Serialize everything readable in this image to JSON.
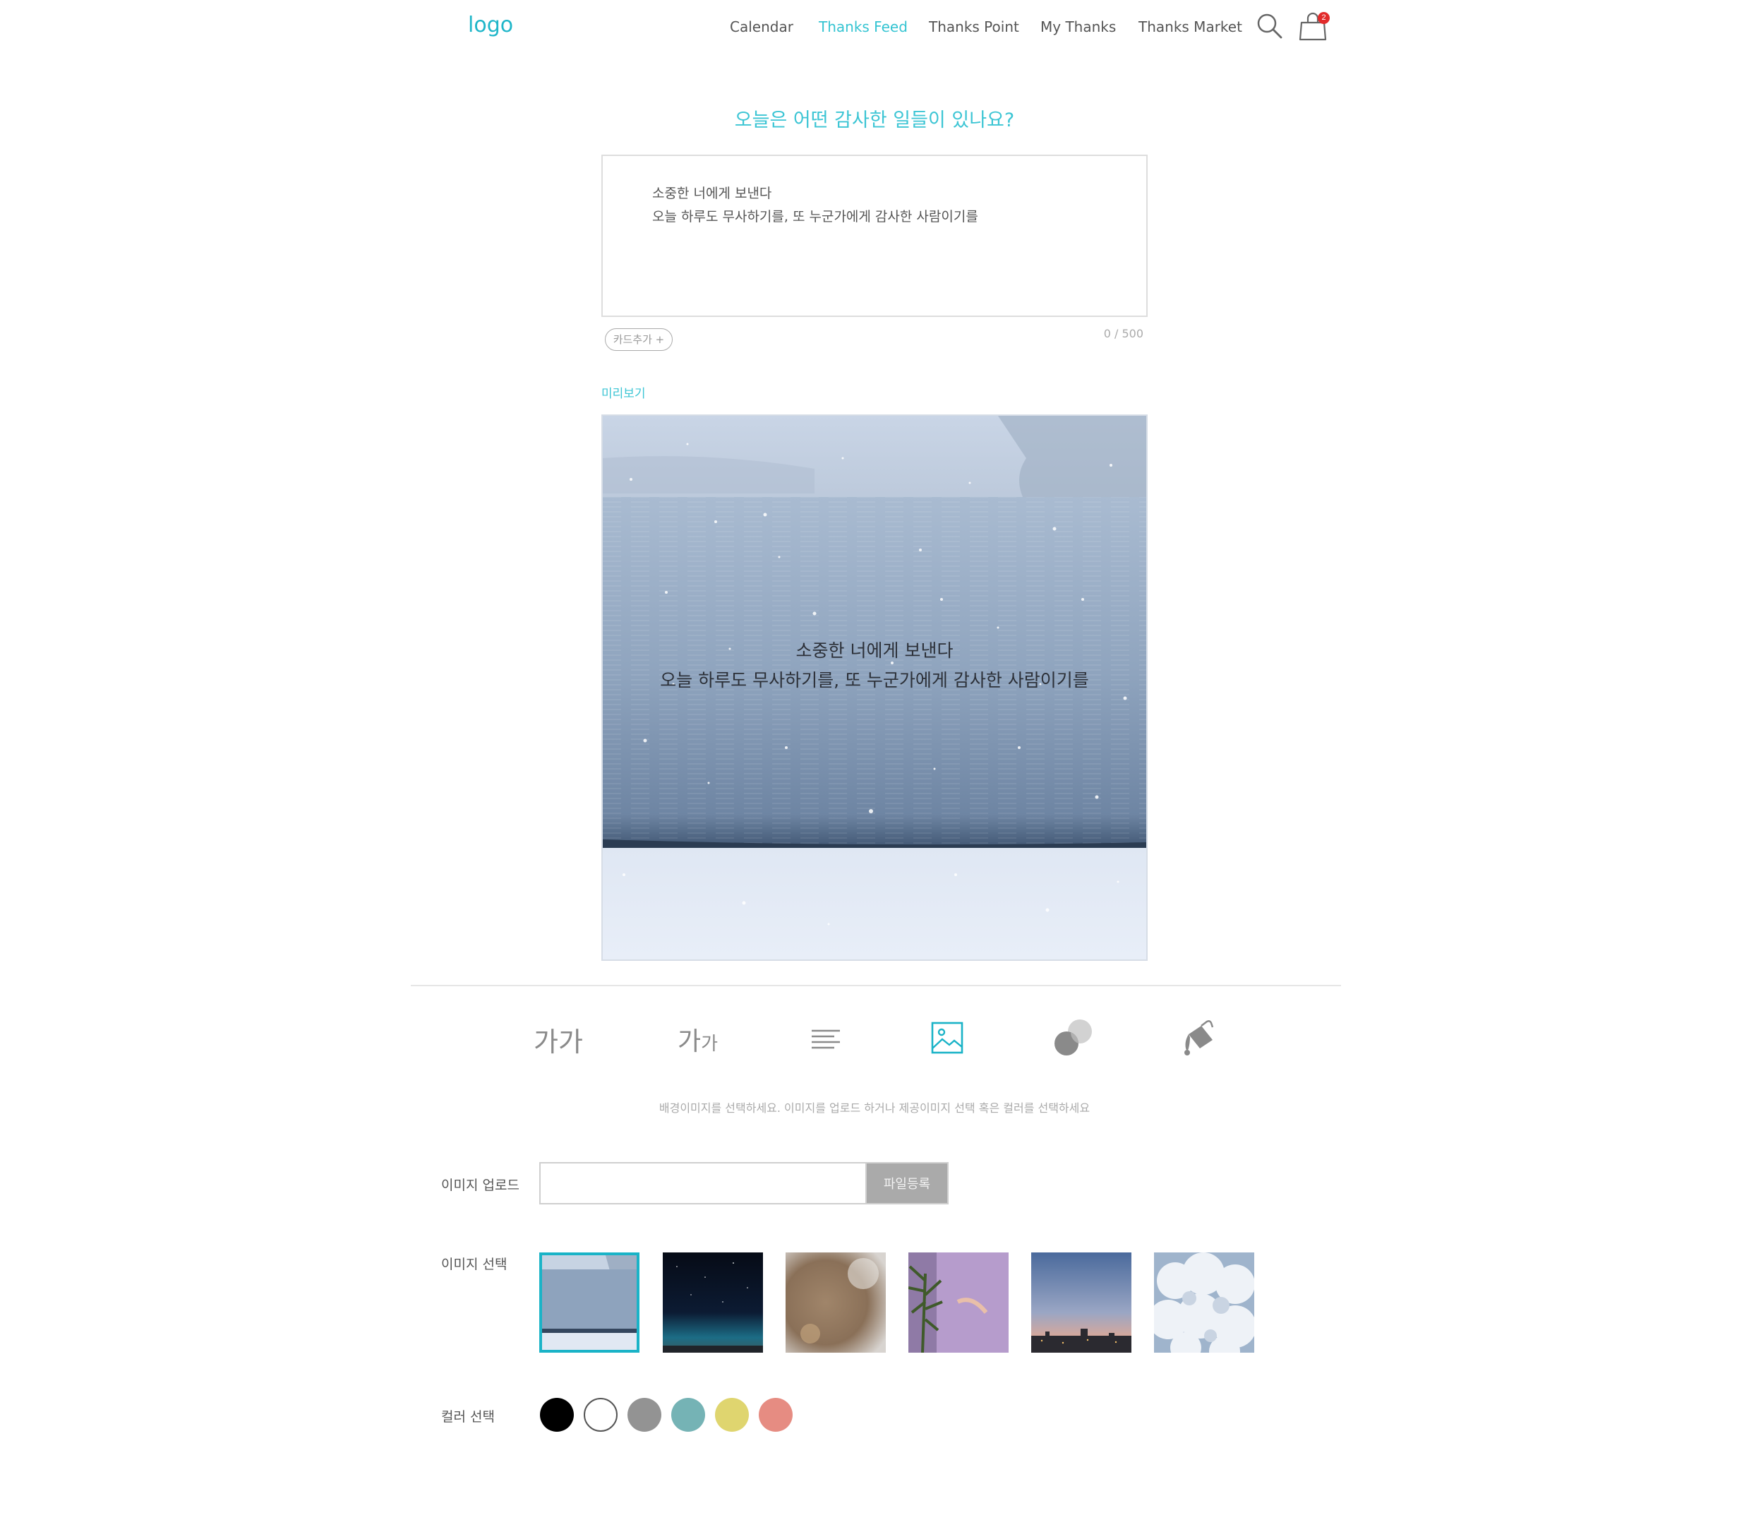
{
  "header": {
    "logo": "logo",
    "nav": [
      {
        "label": "Calendar",
        "active": false
      },
      {
        "label": "Thanks Feed",
        "active": true
      },
      {
        "label": "Thanks Point",
        "active": false
      },
      {
        "label": "My Thanks",
        "active": false
      },
      {
        "label": "Thanks Market",
        "active": false
      }
    ],
    "search_icon": "search-icon",
    "cart_icon": "shopping-bag-icon",
    "cart_count": "2"
  },
  "title": "오늘은 어떤 감사한 일들이 있나요?",
  "editor": {
    "lines": [
      "소중한 너에게 보낸다",
      "오늘 하루도 무사하기를, 또 누군가에게 감사한 사람이기를"
    ],
    "add_card": "카드추가 +",
    "counter": "0 / 500"
  },
  "preview": {
    "label": "미리보기",
    "lines": [
      "소중한 너에게 보낸다",
      "오늘 하루도 무사하기를, 또 누군가에게 감사한 사람이기를"
    ]
  },
  "toolbar": {
    "font_face": "가가",
    "font_size_large": "가",
    "font_size_small": "가",
    "tools": [
      "font-face-tool",
      "font-size-tool",
      "text-align-icon",
      "image-icon",
      "opacity-icon",
      "paint-bucket-icon"
    ],
    "active_tool": "image-icon"
  },
  "hint": "배경이미지를 선택하세요. 이미지를 업로드 하거나 제공이미지 선택 혹은 컬러를 선택하세요",
  "upload": {
    "label": "이미지 업로드",
    "button": "파일등록",
    "value": ""
  },
  "image_select": {
    "label": "이미지 선택",
    "images": [
      "snowy-lake",
      "night-sky",
      "blurred-bokeh",
      "palm-lavender-wall",
      "dusk-city",
      "clouds"
    ],
    "selected": 0
  },
  "color_select": {
    "label": "컬러 선택",
    "colors": [
      "#000000",
      "#ffffff",
      "#939393",
      "#75b3b5",
      "#dfd56f",
      "#e68c82"
    ]
  },
  "accent_color": "#3cc5d4"
}
